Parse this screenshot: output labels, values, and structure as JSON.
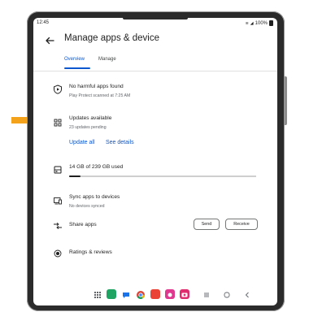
{
  "status_bar": {
    "time": "12:45",
    "battery": "100%"
  },
  "header": {
    "title": "Manage apps & device"
  },
  "tabs": [
    {
      "label": "Overview",
      "active": true
    },
    {
      "label": "Manage",
      "active": false
    }
  ],
  "sections": {
    "protect": {
      "title": "No harmful apps found",
      "subtitle": "Play Protect scanned at 7:25 AM",
      "icon": "play-protect-icon"
    },
    "updates": {
      "title": "Updates available",
      "subtitle": "23 updates pending",
      "update_all_label": "Update all",
      "see_details_label": "See details",
      "icon": "apps-grid-icon"
    },
    "storage": {
      "label": "14 GB of 239 GB used",
      "used_fraction": 0.06,
      "icon": "storage-icon"
    },
    "sync": {
      "title": "Sync apps to devices",
      "subtitle": "No devices synced",
      "icon": "devices-icon"
    },
    "share": {
      "label": "Share apps",
      "send_label": "Send",
      "receive_label": "Receive",
      "icon": "share-arrows-icon"
    },
    "ratings": {
      "label": "Ratings & reviews",
      "icon": "ratings-icon"
    }
  },
  "colors": {
    "accent": "#0b57d0",
    "arrow": "#f4a21c"
  },
  "dock": [
    "apps-drawer-icon",
    "phone-icon",
    "messages-icon",
    "chrome-icon",
    "play-store-icon",
    "galaxy-store-icon",
    "camera-icon"
  ],
  "nav_buttons": [
    "recents-button",
    "home-button",
    "back-button"
  ]
}
